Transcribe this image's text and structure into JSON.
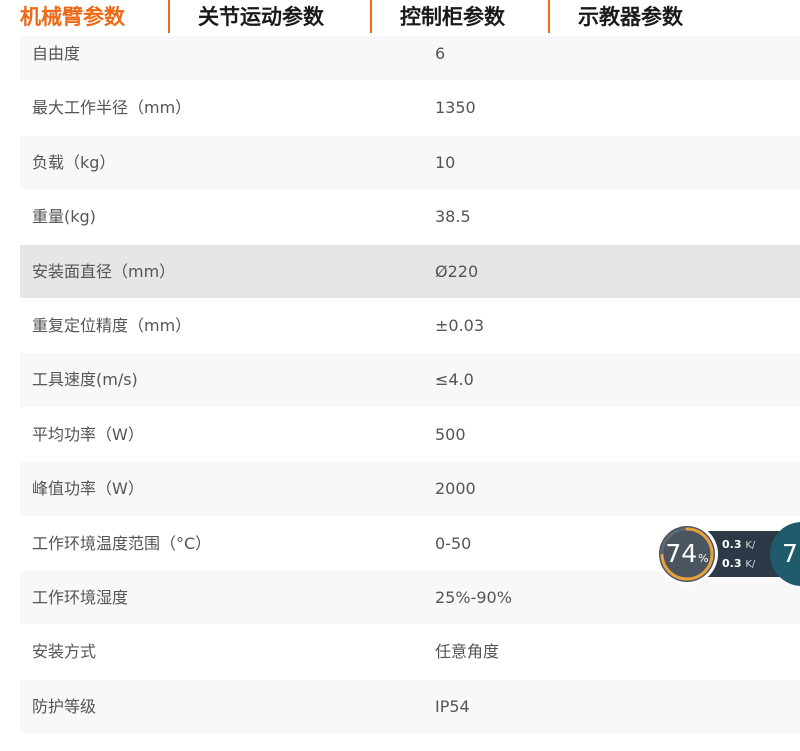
{
  "tabs": [
    {
      "label": "机械臂参数",
      "active": true
    },
    {
      "label": "关节运动参数",
      "active": false
    },
    {
      "label": "控制柜参数",
      "active": false
    },
    {
      "label": "示教器参数",
      "active": false
    }
  ],
  "colors": {
    "accent": "#ee6a17",
    "row_odd": "#f8f8f8",
    "row_even": "#ffffff",
    "row_highlight": "#e6e6e6"
  },
  "rows": [
    {
      "key": "自由度",
      "value": "6"
    },
    {
      "key": "最大工作半径（mm）",
      "value": "1350"
    },
    {
      "key": "负载（kg）",
      "value": "10"
    },
    {
      "key": "重量(kg)",
      "value": "38.5"
    },
    {
      "key": "安装面直径（mm）",
      "value": "Ø220"
    },
    {
      "key": "重复定位精度（mm）",
      "value": "±0.03"
    },
    {
      "key": "工具速度(m/s)",
      "value": "≤4.0"
    },
    {
      "key": "平均功率（W）",
      "value": "500"
    },
    {
      "key": "峰值功率（W）",
      "value": "2000"
    },
    {
      "key": "工作环境温度范围（°C）",
      "value": "0-50"
    },
    {
      "key": "工作环境湿度",
      "value": "25%-90%"
    },
    {
      "key": "安装方式",
      "value": "任意角度"
    },
    {
      "key": "防护等级",
      "value": "IP54"
    }
  ],
  "widget": {
    "usage_value": "74",
    "usage_unit": "%",
    "usage_fraction": 0.74,
    "upload_speed": "0.3",
    "download_speed": "0.3",
    "speed_unit": "K/",
    "second_value": "7"
  }
}
